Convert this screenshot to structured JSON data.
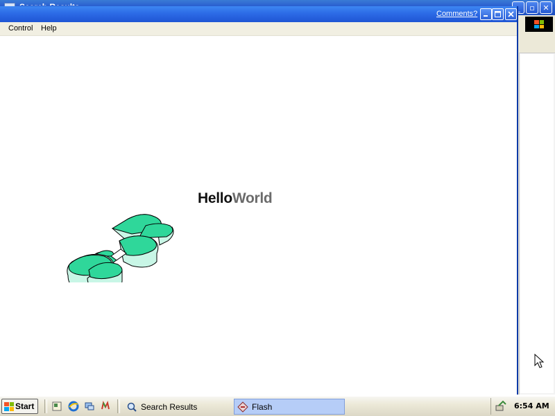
{
  "background_window": {
    "title": "Search Results",
    "buttons": [
      "minimize",
      "maximize",
      "close"
    ]
  },
  "flash_window": {
    "comments_link": "Comments?",
    "titlebar_buttons": [
      "_",
      "□",
      "✕"
    ],
    "menu": [
      {
        "label": "Control"
      },
      {
        "label": "Help"
      }
    ],
    "stage": {
      "hello": "Hello",
      "world": "World",
      "clover_color": "#2fd79a",
      "clover_side_color": "#c8f6e6"
    }
  },
  "taskbar": {
    "start_label": "Start",
    "quick_launch": [
      "show-desktop-icon",
      "internet-explorer-icon",
      "network-icon",
      "messenger-icon"
    ],
    "tasks": [
      {
        "label": "Search Results",
        "icon": "search-icon",
        "active": false
      },
      {
        "label": "Flash",
        "icon": "flash-icon",
        "active": true
      }
    ],
    "clock": "6:54 AM"
  }
}
